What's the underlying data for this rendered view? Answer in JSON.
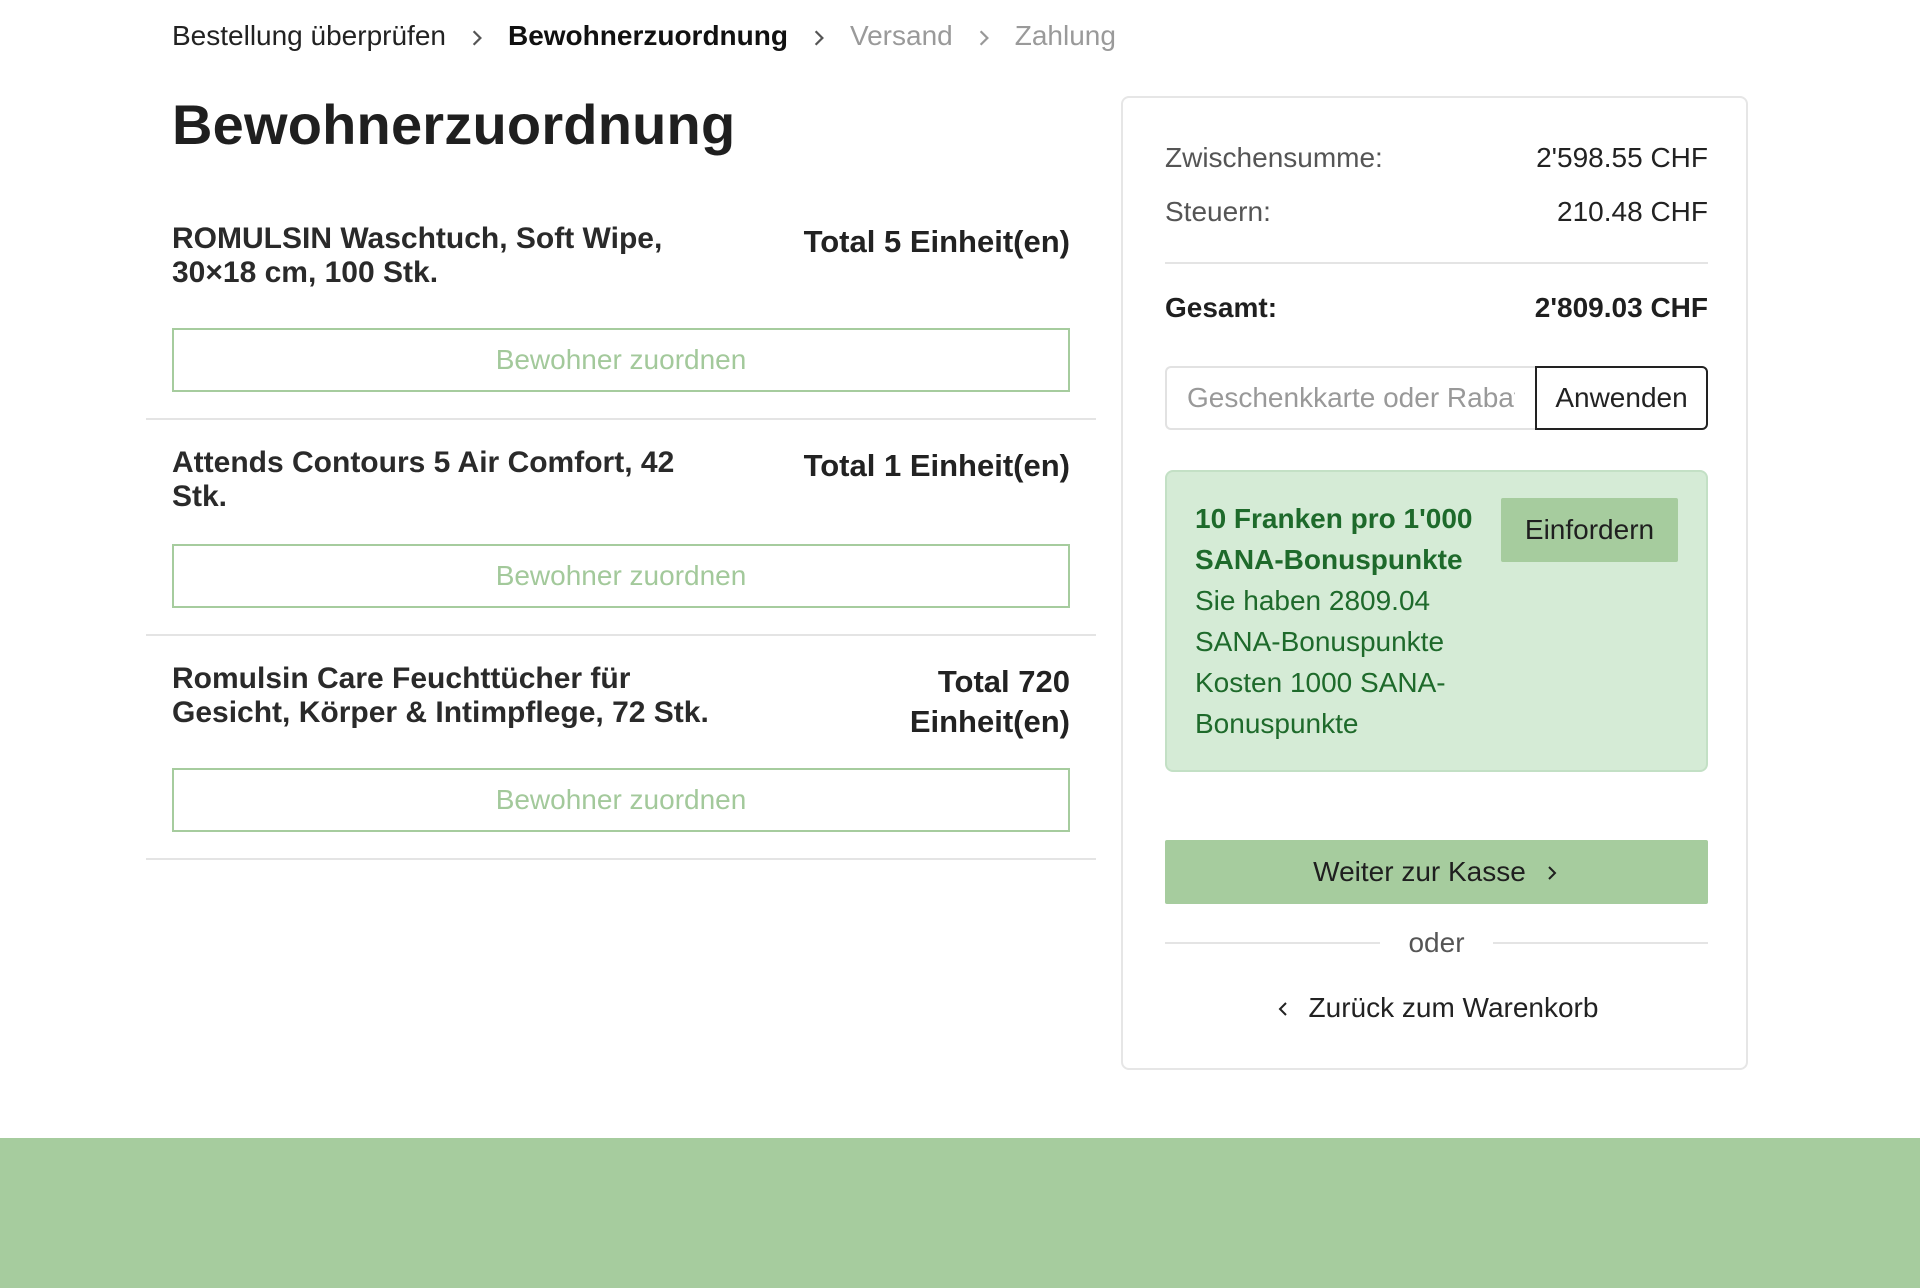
{
  "breadcrumb": {
    "steps": [
      {
        "label": "Bestellung überprüfen",
        "state": "done"
      },
      {
        "label": "Bewohnerzuordnung",
        "state": "active"
      },
      {
        "label": "Versand",
        "state": "upcoming"
      },
      {
        "label": "Zahlung",
        "state": "upcoming"
      }
    ]
  },
  "main": {
    "title": "Bewohnerzuordnung",
    "assign_label": "Bewohner zuordnen",
    "items": [
      {
        "name": "ROMULSIN Waschtuch, Soft Wipe, 30×18 cm, 100 Stk.",
        "total": "Total 5 Einheit(en)"
      },
      {
        "name": "Attends Contours 5 Air Comfort, 42 Stk.",
        "total": "Total 1 Einheit(en)"
      },
      {
        "name": "Romulsin Care Feuchttücher für Gesicht, Körper & Intimpflege, 72 Stk.",
        "total": "Total 720 Einheit(en)"
      }
    ]
  },
  "summary": {
    "subtotal_label": "Zwischensumme:",
    "subtotal_value": "2'598.55 CHF",
    "tax_label": "Steuern:",
    "tax_value": "210.48 CHF",
    "total_label": "Gesamt:",
    "total_value": "2'809.03 CHF",
    "coupon_placeholder": "Geschenkkarte oder Rabattcode",
    "apply_label": "Anwenden",
    "bonus": {
      "title": "10 Franken pro 1'000 SANA-Bonuspunkte",
      "balance": "Sie haben 2809.04 SANA-Bonuspunkte",
      "cost": "Kosten 1000 SANA-Bonuspunkte",
      "claim_label": "Einfordern"
    },
    "checkout_label": "Weiter zur Kasse",
    "or_label": "oder",
    "back_label": "Zurück zum Warenkorb"
  },
  "colors": {
    "accent_green": "#a6cc9e",
    "bonus_bg": "#d5ebd6",
    "bonus_text": "#1e6a2b"
  }
}
